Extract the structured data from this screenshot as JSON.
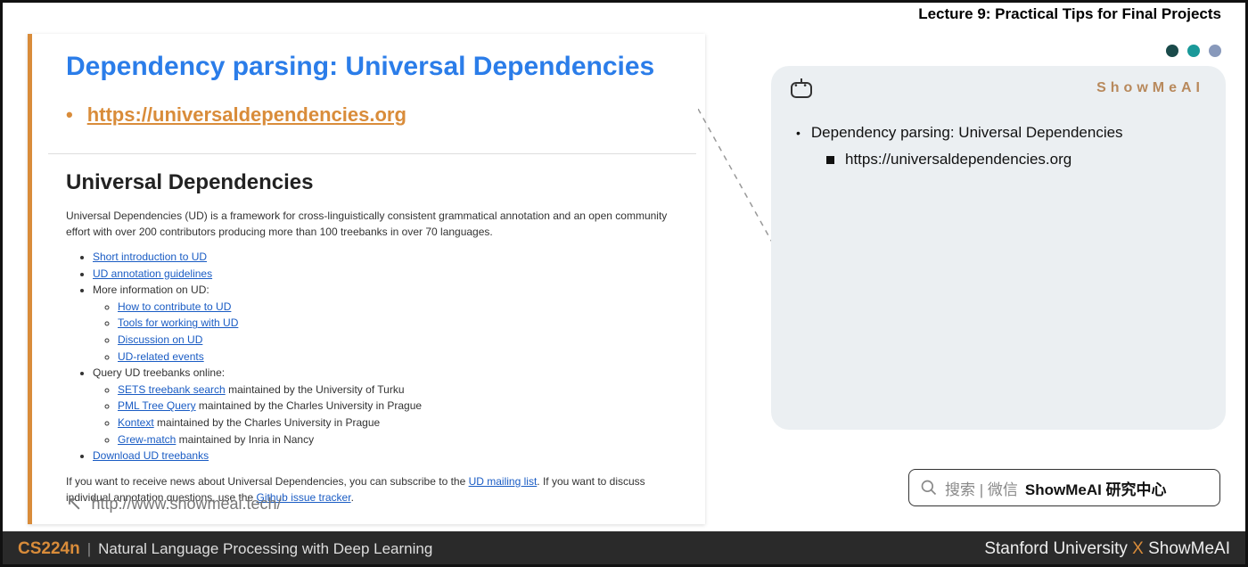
{
  "header": {
    "lecture_title": "Lecture 9: Practical Tips for Final Projects"
  },
  "slide": {
    "title": "Dependency parsing: Universal Dependencies",
    "main_link": "https://universaldependencies.org",
    "section_heading": "Universal Dependencies",
    "intro": "Universal Dependencies (UD) is a framework for cross-linguistically consistent grammatical annotation and an open community effort with over 200 contributors producing more than 100 treebanks in over 70 languages.",
    "items": {
      "short_intro": "Short introduction to UD",
      "guidelines": "UD annotation guidelines",
      "more_info": "More information on UD:",
      "contribute": "How to contribute to UD",
      "tools": "Tools for working with UD",
      "discussion": "Discussion on UD",
      "events": "UD-related events",
      "query": "Query UD treebanks online:",
      "sets": "SETS treebank search",
      "sets_by": " maintained by the University of Turku",
      "pml": "PML Tree Query",
      "pml_by": " maintained by the Charles University in Prague",
      "kontext": "Kontext",
      "kontext_by": " maintained by the Charles University in Prague",
      "grew": "Grew-match",
      "grew_by": " maintained by Inria in Nancy",
      "download": "Download UD treebanks"
    },
    "news_pre": "If you want to receive news about Universal Dependencies, you can subscribe to the ",
    "news_link": "UD mailing list",
    "news_post": ". If you want to discuss individual annotation questions, use the ",
    "github_link": "Github issue tracker",
    "footer_url": "http://www.showmeai.tech/"
  },
  "notes": {
    "brand": "ShowMeAI",
    "title": "Dependency parsing: Universal Dependencies",
    "link": "https://universaldependencies.org"
  },
  "search": {
    "prefix": "搜索 | 微信",
    "bold": "ShowMeAI 研究中心"
  },
  "footer": {
    "code": "CS224n",
    "course": "Natural Language Processing with Deep Learning",
    "uni": "Stanford University",
    "x": "X",
    "brand": "ShowMeAI"
  }
}
